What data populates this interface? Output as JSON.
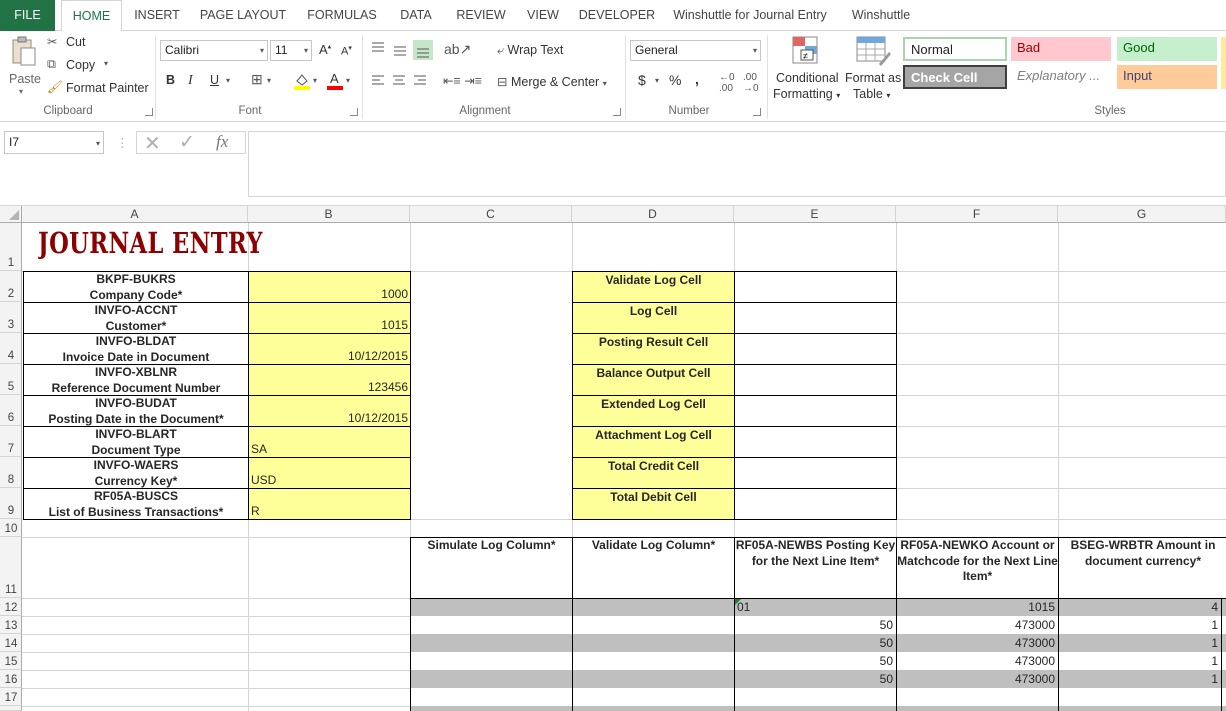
{
  "tabs": [
    "FILE",
    "HOME",
    "INSERT",
    "PAGE LAYOUT",
    "FORMULAS",
    "DATA",
    "REVIEW",
    "VIEW",
    "DEVELOPER",
    "Winshuttle for Journal Entry",
    "Winshuttle"
  ],
  "clipboard": {
    "paste": "Paste",
    "cut": "Cut",
    "copy": "Copy",
    "format_painter": "Format Painter",
    "label": "Clipboard"
  },
  "font": {
    "name": "Calibri",
    "size": "11",
    "bold": "B",
    "italic": "I",
    "underline": "U",
    "label": "Font"
  },
  "alignment": {
    "wrap": "Wrap Text",
    "merge": "Merge & Center",
    "label": "Alignment"
  },
  "number": {
    "format": "General",
    "currency": "$",
    "percent": "%",
    "comma": ",",
    "label": "Number"
  },
  "styles_group": {
    "conditional": "Conditional",
    "conditional2": "Formatting",
    "format_as": "Format as",
    "format_as2": "Table",
    "normal": "Normal",
    "bad": "Bad",
    "good": "Good",
    "check": "Check Cell",
    "explanatory": "Explanatory ...",
    "input": "Input",
    "label": "Styles"
  },
  "formula_bar": {
    "name_box": "I7",
    "fx": "fx",
    "value": ""
  },
  "columns": [
    "A",
    "B",
    "C",
    "D",
    "E",
    "F",
    "G"
  ],
  "rows": [
    "1",
    "2",
    "3",
    "4",
    "5",
    "6",
    "7",
    "8",
    "9",
    "10",
    "11",
    "12",
    "13",
    "14",
    "15",
    "16",
    "17"
  ],
  "title": "JOURNAL ENTRY",
  "header_fields": [
    {
      "code": "BKPF-BUKRS",
      "desc": "Company Code*",
      "value": "1000"
    },
    {
      "code": "INVFO-ACCNT",
      "desc": "Customer*",
      "value": "1015"
    },
    {
      "code": "INVFO-BLDAT",
      "desc": "Invoice Date in Document",
      "value": "10/12/2015"
    },
    {
      "code": "INVFO-XBLNR",
      "desc": "Reference Document Number",
      "value": "123456"
    },
    {
      "code": "INVFO-BUDAT",
      "desc": "Posting Date in the Document*",
      "value": "10/12/2015"
    },
    {
      "code": "INVFO-BLART",
      "desc": "Document Type",
      "value": "SA"
    },
    {
      "code": "INVFO-WAERS",
      "desc": "Currency Key*",
      "value": "USD"
    },
    {
      "code": "RF05A-BUSCS",
      "desc": "List of Business Transactions*",
      "value": "R"
    }
  ],
  "log_cells": [
    "Validate Log Cell",
    "Log Cell",
    "Posting Result Cell",
    "Balance Output Cell",
    "Extended Log Cell",
    "Attachment Log Cell",
    "Total Credit Cell",
    "Total Debit Cell"
  ],
  "data_headers": {
    "c": "Simulate Log Column*",
    "d": "Validate Log Column*",
    "e": "RF05A-NEWBS Posting Key for the Next Line Item*",
    "f": "RF05A-NEWKO Account or Matchcode for the Next Line Item*",
    "g": "BSEG-WRBTR Amount in document currency*"
  },
  "data_rows": [
    {
      "e": "01",
      "f": "1015",
      "g": "4"
    },
    {
      "e": "50",
      "f": "473000",
      "g": "1"
    },
    {
      "e": "50",
      "f": "473000",
      "g": "1"
    },
    {
      "e": "50",
      "f": "473000",
      "g": "1"
    },
    {
      "e": "50",
      "f": "473000",
      "g": "1"
    }
  ]
}
